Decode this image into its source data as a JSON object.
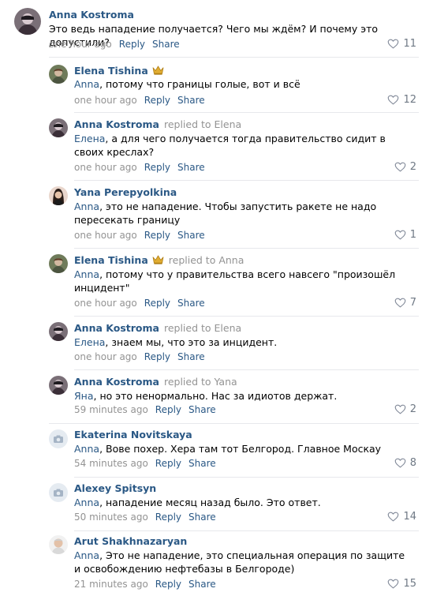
{
  "actions": {
    "reply": "Reply",
    "share": "Share"
  },
  "comments": [
    {
      "author": "Anna Kostroma",
      "replied_to": "",
      "crown": false,
      "addressee": "",
      "text": "Это ведь нападение получается? Чего мы ждём? И почему это допустили?",
      "time": "one hour ago",
      "likes": "11",
      "avatar": "avatar-dark"
    },
    {
      "author": "Elena Tishina",
      "replied_to": "",
      "crown": true,
      "addressee": "Anna",
      "text": ", потому что границы голые, вот и всё",
      "time": "one hour ago",
      "likes": "12",
      "avatar": "avatar-photo"
    },
    {
      "author": "Anna Kostroma",
      "replied_to": "replied to Elena",
      "crown": false,
      "addressee": "Елена",
      "text": ", а для чего получается тогда правительство сидит в своих креслах?",
      "time": "one hour ago",
      "likes": "2",
      "avatar": "avatar-dark"
    },
    {
      "author": "Yana Perepyolkina",
      "replied_to": "",
      "crown": false,
      "addressee": "Anna",
      "text": ", это не нападение. Чтобы запустить ракете не надо пересекать границу",
      "time": "one hour ago",
      "likes": "1",
      "avatar": "avatar-woman"
    },
    {
      "author": "Elena Tishina",
      "replied_to": "replied to Anna",
      "crown": true,
      "addressee": "Anna",
      "text": ", потому что у правительства всего навсего \"произошёл инцидент\"",
      "time": "one hour ago",
      "likes": "7",
      "avatar": "avatar-photo"
    },
    {
      "author": "Anna Kostroma",
      "replied_to": "replied to Elena",
      "crown": false,
      "addressee": "Елена",
      "text": ", знаем мы, что это за инцидент.",
      "time": "one hour ago",
      "likes": "",
      "avatar": "avatar-dark"
    },
    {
      "author": "Anna Kostroma",
      "replied_to": "replied to Yana",
      "crown": false,
      "addressee": "Яна",
      "text": ", но это ненормально. Нас за идиотов держат.",
      "time": "59 minutes ago",
      "likes": "2",
      "avatar": "avatar-dark"
    },
    {
      "author": "Ekaterina Novitskaya",
      "replied_to": "",
      "crown": false,
      "addressee": "Anna",
      "text": ", Вове похер. Хера там тот Белгород. Главное Москау",
      "time": "54 minutes ago",
      "likes": "8",
      "avatar": "camera-placeholder-icon"
    },
    {
      "author": "Alexey Spitsyn",
      "replied_to": "",
      "crown": false,
      "addressee": "Anna",
      "text": ", нападение месяц назад было. Это ответ.",
      "time": "50 minutes ago",
      "likes": "14",
      "avatar": "camera-placeholder-icon"
    },
    {
      "author": "Arut Shakhnazaryan",
      "replied_to": "",
      "crown": false,
      "addressee": "Anna",
      "text": ", Это не нападение, это специальная операция по защите и освобождению нефтебазы в Белгороде)",
      "time": "21 minutes ago",
      "likes": "15",
      "avatar": "avatar-man"
    }
  ],
  "colors": {
    "link": "#2a5885",
    "muted": "#939393",
    "separator": "#e7e8ec",
    "crown": "#d9a22a"
  }
}
